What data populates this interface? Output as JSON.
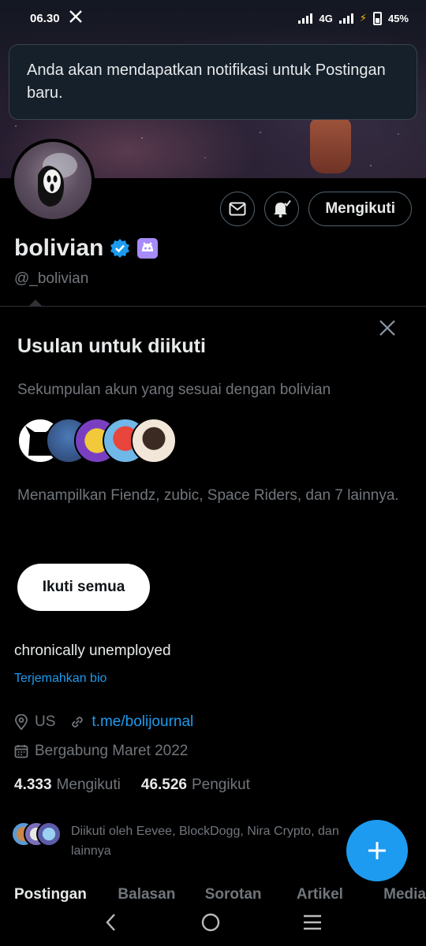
{
  "status_bar": {
    "time": "06.30",
    "network": "4G",
    "battery": "45%"
  },
  "toast": {
    "message": "Anda akan mendapatkan notifikasi untuk Postingan baru."
  },
  "profile": {
    "display_name": "bolivian",
    "handle": "@_bolivian",
    "follow_button_label": "Mengikuti",
    "bio": "chronically unemployed",
    "translate_bio_label": "Terjemahkan bio",
    "location": "US",
    "link": "t.me/bolijournal",
    "joined": "Bergabung Maret 2022",
    "following_count": "4.333",
    "following_label": "Mengikuti",
    "followers_count": "46.526",
    "followers_label": "Pengikut",
    "followed_by": "Diikuti oleh Eevee, BlockDogg, Nira Crypto, dan lainnya"
  },
  "suggestions": {
    "title": "Usulan untuk diikuti",
    "subtitle": "Sekumpulan akun yang sesuai dengan bolivian",
    "description": "Menampilkan Fiendz, zubic, Space Riders, dan 7 lainnya.",
    "follow_all_label": "Ikuti semua"
  },
  "tabs": [
    {
      "label": "Postingan"
    },
    {
      "label": "Balasan"
    },
    {
      "label": "Sorotan"
    },
    {
      "label": "Artikel"
    },
    {
      "label": "Media"
    }
  ],
  "colors": {
    "accent": "#1d9bf0",
    "background": "#000000",
    "muted_text": "#71767b",
    "toast_background": "#15202b",
    "badge_purple": "#a78bfa"
  }
}
